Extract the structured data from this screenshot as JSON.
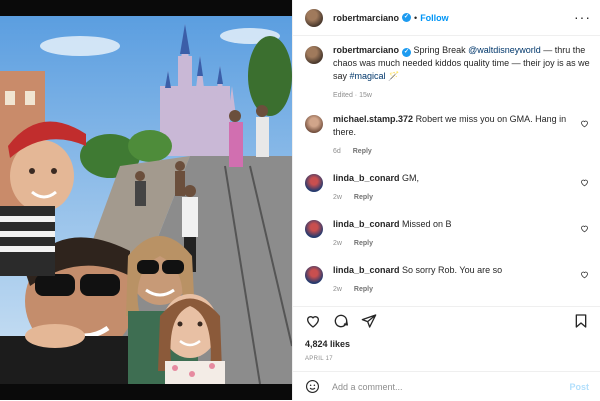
{
  "post": {
    "username": "robertmarciano",
    "follow_label": "Follow",
    "dot": "•",
    "more_label": "···",
    "caption": {
      "prefix": "Spring Break ",
      "mention": "@waltdisneyworld",
      "middle": " — thru the chaos was much needed kiddos quality time — their joy is as we say ",
      "hashtag": "#magical",
      "suffix": " 🪄",
      "meta_edited": "Edited",
      "meta_sep": " · ",
      "meta_time": "15w"
    },
    "comments": [
      {
        "user": "michael.stamp.372",
        "text": "Robert we miss you on GMA. Hang in there.",
        "time": "6d",
        "reply": "Reply"
      },
      {
        "user": "linda_b_conard",
        "text": "GM,",
        "time": "2w",
        "reply": "Reply"
      },
      {
        "user": "linda_b_conard",
        "text": "Missed on B",
        "time": "2w",
        "reply": "Reply"
      },
      {
        "user": "linda_b_conard",
        "text": "So sorry Rob. You are so",
        "time": "2w",
        "reply": "Reply"
      }
    ],
    "likes": "4,824 likes",
    "date": "APRIL 17",
    "add_comment_placeholder": "Add a comment...",
    "post_label": "Post"
  },
  "colors": {
    "accent": "#0095f6",
    "verified": "#1d9bf0",
    "link": "#00376b",
    "muted": "#8e8e8e"
  },
  "icons": [
    "heart-icon",
    "comment-icon",
    "share-icon",
    "bookmark-icon",
    "emoji-icon",
    "verified-badge-icon",
    "more-options-icon"
  ]
}
